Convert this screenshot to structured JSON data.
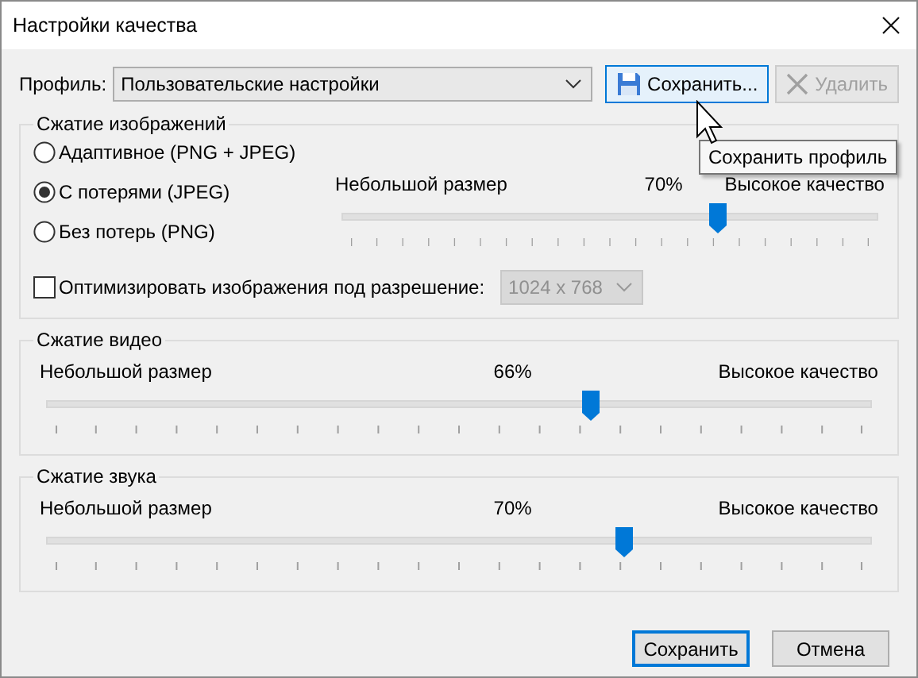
{
  "window": {
    "title": "Настройки качества"
  },
  "profile": {
    "label": "Профиль:",
    "value": "Пользовательские настройки",
    "save_button": {
      "label": "Сохранить...",
      "hovered": true
    },
    "delete_button": {
      "label": "Удалить",
      "disabled": true
    }
  },
  "tooltip": {
    "text": "Сохранить профиль"
  },
  "image_compression": {
    "title": "Сжатие изображений",
    "options": [
      {
        "label": "Адаптивное (PNG + JPEG)",
        "selected": false
      },
      {
        "label": "С потерями (JPEG)",
        "selected": true
      },
      {
        "label": "Без потерь (PNG)",
        "selected": false
      }
    ],
    "slider": {
      "min_label": "Небольшой размер",
      "value_label": "70%",
      "max_label": "Высокое качество",
      "level": 0.7
    },
    "optimize": {
      "label": "Оптимизировать изображения под разрешение:",
      "checked": false,
      "resolution": "1024 x 768",
      "disabled": true
    }
  },
  "video_compression": {
    "title": "Сжатие видео",
    "slider": {
      "min_label": "Небольшой размер",
      "value_label": "66%",
      "max_label": "Высокое качество",
      "level": 0.66
    }
  },
  "audio_compression": {
    "title": "Сжатие звука",
    "slider": {
      "min_label": "Небольшой размер",
      "value_label": "70%",
      "max_label": "Высокое качество",
      "level": 0.7
    }
  },
  "buttons": [
    {
      "label": "Сохранить",
      "default": true
    },
    {
      "label": "Отмена",
      "default": false
    }
  ]
}
